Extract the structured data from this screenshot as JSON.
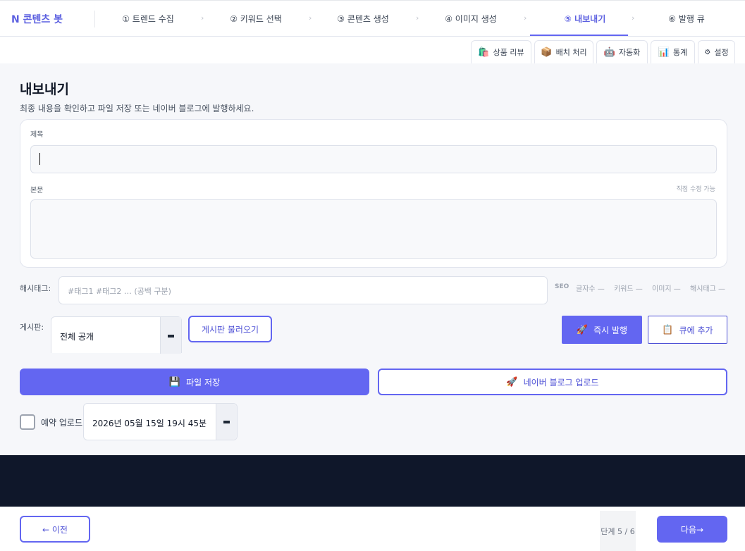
{
  "header": {
    "brand": "N 콘텐츠 봇",
    "steps": [
      {
        "label": "① 트렌드 수집"
      },
      {
        "label": "② 키워드 선택"
      },
      {
        "label": "③ 콘텐츠 생성"
      },
      {
        "label": "④ 이미지 생성"
      },
      {
        "label": "⑤ 내보내기"
      },
      {
        "label": "⑥ 발행 큐"
      }
    ],
    "chevron": "›",
    "active_step": 5
  },
  "subtabs": [
    {
      "icon": "🛍️",
      "label": "상품 리뷰"
    },
    {
      "icon": "📦",
      "label": "배치 처리"
    },
    {
      "icon": "🤖",
      "label": "자동화"
    },
    {
      "icon": "📊",
      "label": "통계"
    },
    {
      "icon": "⚙",
      "label": "설정"
    }
  ],
  "page": {
    "title": "내보내기",
    "subtitle": "최종 내용을 확인하고 파일 저장 또는 네이버 블로그에 발행하세요."
  },
  "editor": {
    "title_label": "제목",
    "title_value": "",
    "body_label": "본문",
    "body_hint": "직접 수정 가능",
    "body_value": ""
  },
  "hashtags": {
    "label": "해시태그:",
    "placeholder": "#태그1 #태그2 … (공백 구분)"
  },
  "seo": {
    "label": "SEO",
    "items": [
      "글자수 —",
      "키워드 —",
      "이미지 —",
      "해시태그 —"
    ]
  },
  "board": {
    "label": "게시판:",
    "selected": "전체 공개",
    "load_button": "게시판 불러오기"
  },
  "publish": {
    "instant_icon": "🚀",
    "instant_label": "즉시 발행",
    "queue_icon": "📋",
    "queue_label": "큐에 추가"
  },
  "actions": {
    "save_icon": "💾",
    "save_label": "파일 저장",
    "upload_icon": "🚀",
    "upload_label": "네이버 블로그 업로드"
  },
  "schedule": {
    "label": "예약 업로드",
    "checked": false,
    "datetime": "2026년 05월 15일 19시 45분"
  },
  "footer": {
    "prev_label": "← 이전",
    "step_count": "단계  5 / 6",
    "next_label": "다음→"
  },
  "colors": {
    "accent": "#6366f1",
    "dark_band": "#0f172a"
  }
}
